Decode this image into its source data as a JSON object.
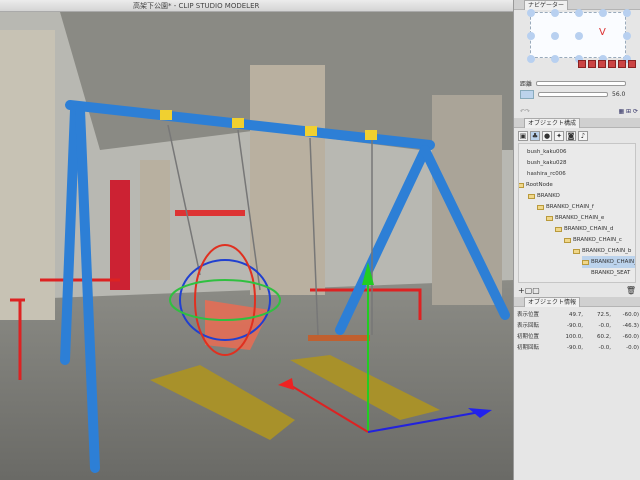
{
  "window": {
    "title": "高架下公園* - CLIP STUDIO MODELER"
  },
  "navigator": {
    "tab_label": "ナビゲーター",
    "distance_label": "距離",
    "angle_value": "56.0"
  },
  "object_tree": {
    "tab_label": "オブジェクト構成",
    "items": [
      {
        "label": "bush_kaku006",
        "level": 1,
        "folder": false,
        "selected": false
      },
      {
        "label": "bush_kaku028",
        "level": 1,
        "folder": false,
        "selected": false
      },
      {
        "label": "hashira_rc006",
        "level": 1,
        "folder": false,
        "selected": false
      },
      {
        "label": "RootNode",
        "level": 0,
        "folder": true,
        "selected": false
      },
      {
        "label": "BRANKO",
        "level": 1,
        "folder": true,
        "selected": false
      },
      {
        "label": "BRANKO_CHAIN_f",
        "level": 2,
        "folder": true,
        "selected": false
      },
      {
        "label": "BRANKO_CHAIN_e",
        "level": 3,
        "folder": true,
        "selected": false
      },
      {
        "label": "BRANKO_CHAIN_d",
        "level": 4,
        "folder": true,
        "selected": false
      },
      {
        "label": "BRANKO_CHAIN_c",
        "level": 5,
        "folder": true,
        "selected": false
      },
      {
        "label": "BRANKO_CHAIN_b",
        "level": 6,
        "folder": true,
        "selected": false
      },
      {
        "label": "BRANKO_CHAIN_a",
        "level": 7,
        "folder": true,
        "selected": true
      },
      {
        "label": "BRANKO_SEAT",
        "level": 8,
        "folder": false,
        "selected": false
      }
    ]
  },
  "object_info": {
    "tab_label": "オブジェクト情報",
    "rows": [
      {
        "label": "表示位置",
        "x": "49.7,",
        "y": "72.5,",
        "z": "-60.0)"
      },
      {
        "label": "表示回転",
        "x": "-90.0,",
        "y": "-0.0,",
        "z": "-46.3)"
      },
      {
        "label": "初期位置",
        "x": "100.0,",
        "y": "60.2,",
        "z": "-60.0)"
      },
      {
        "label": "初期回転",
        "x": "-90.0,",
        "y": "-0.0,",
        "z": "-0.0)"
      }
    ]
  }
}
